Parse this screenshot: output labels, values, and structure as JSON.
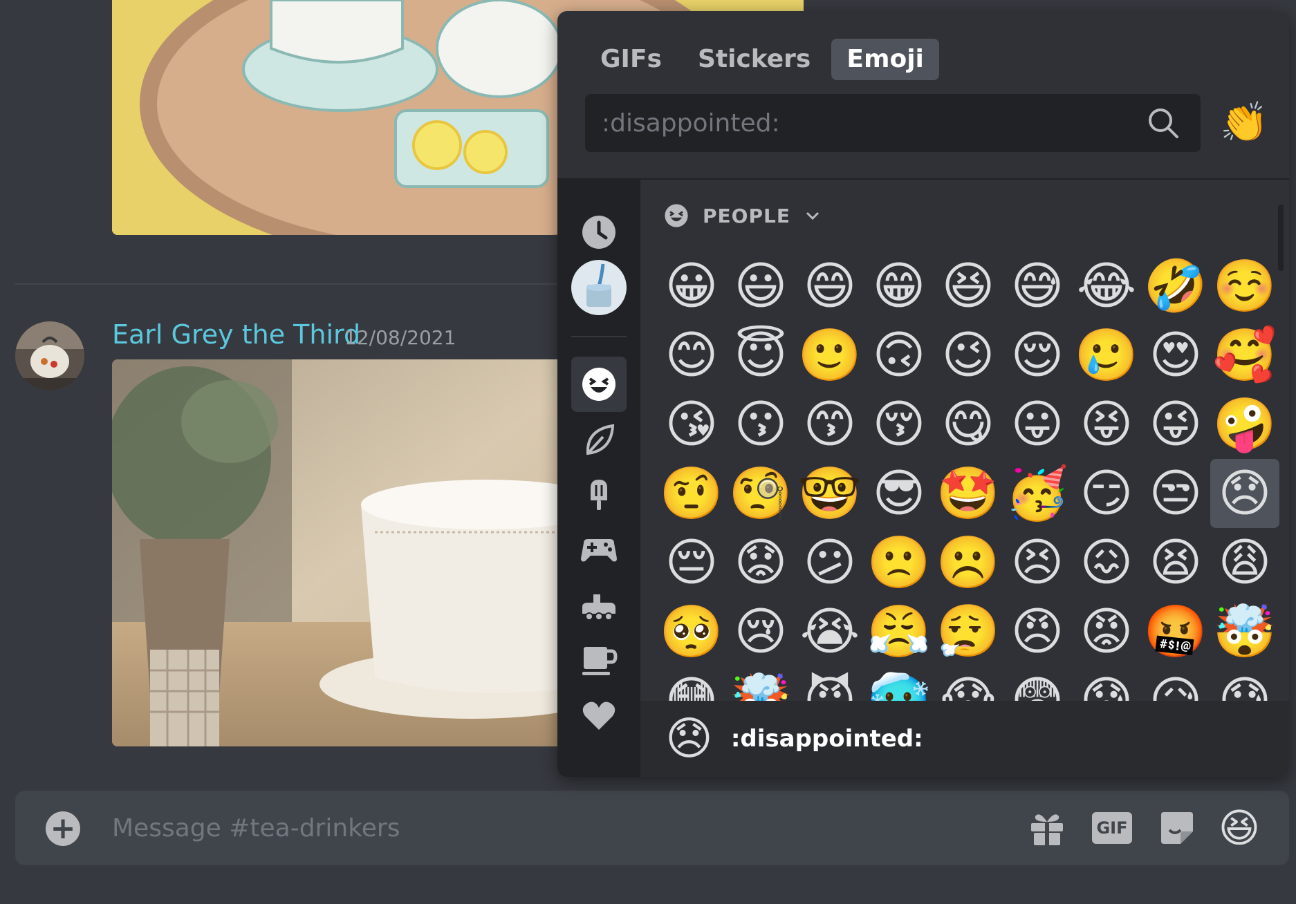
{
  "chat": {
    "message": {
      "author": "Earl Grey the Third",
      "timestamp": "12/08/2021"
    },
    "composer": {
      "placeholder": "Message #tea-drinkers",
      "gif_label": "GIF"
    }
  },
  "emoji_picker": {
    "tabs": [
      {
        "label": "GIFs",
        "active": false
      },
      {
        "label": "Stickers",
        "active": false
      },
      {
        "label": "Emoji",
        "active": true
      }
    ],
    "search": {
      "placeholder": ":disappointed:",
      "value": ""
    },
    "skin_tone_emoji": "👏",
    "categories": [
      {
        "name": "recent",
        "icon": "clock-icon"
      },
      {
        "name": "server",
        "icon": "server-avatar"
      },
      {
        "name": "people",
        "icon": "smiley-icon",
        "active": true
      },
      {
        "name": "nature",
        "icon": "leaf-icon"
      },
      {
        "name": "food",
        "icon": "popsicle-icon"
      },
      {
        "name": "activities",
        "icon": "gamepad-icon"
      },
      {
        "name": "travel",
        "icon": "vehicle-icon"
      },
      {
        "name": "objects",
        "icon": "mug-icon"
      },
      {
        "name": "symbols",
        "icon": "heart-icon"
      }
    ],
    "section": {
      "title": "PEOPLE"
    },
    "emojis": [
      "😀",
      "😃",
      "😄",
      "😁",
      "😆",
      "😅",
      "😂",
      "🤣",
      "☺️",
      "😊",
      "😇",
      "🙂",
      "🙃",
      "😉",
      "😌",
      "🥲",
      "😍",
      "🥰",
      "😘",
      "😗",
      "😙",
      "😚",
      "😋",
      "😛",
      "😝",
      "😜",
      "🤪",
      "🤨",
      "🧐",
      "🤓",
      "😎",
      "🤩",
      "🥳",
      "😏",
      "😒",
      "😞",
      "😔",
      "😟",
      "😕",
      "🙁",
      "☹️",
      "😣",
      "😖",
      "😫",
      "😩",
      "🥺",
      "😢",
      "😭",
      "😤",
      "😮‍💨",
      "😠",
      "😡",
      "🤬",
      "🤯",
      "😳",
      "🤯",
      "😈",
      "🥶",
      "😱",
      "😨",
      "😰",
      "😥",
      "😓"
    ],
    "selected_index": 35,
    "preview": {
      "emoji": "😞",
      "name": ":disappointed:"
    }
  },
  "colors": {
    "background": "#36393f",
    "picker": "#2f3136",
    "author": "#5bc8de"
  }
}
